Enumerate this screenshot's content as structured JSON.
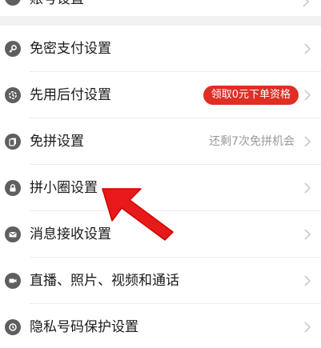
{
  "top_row": {
    "label": "账号设置",
    "icon": "settings-icon"
  },
  "rows": [
    {
      "label": "免密支付设置",
      "icon": "key-icon"
    },
    {
      "label": "先用后付设置",
      "icon": "pay-later-icon",
      "badge": "领取0元下单资格"
    },
    {
      "label": "免拼设置",
      "icon": "group-free-icon",
      "hint": "还剩7次免拼机会"
    },
    {
      "label": "拼小圈设置",
      "icon": "lock-icon"
    },
    {
      "label": "消息接收设置",
      "icon": "mail-icon"
    },
    {
      "label": "直播、照片、视频和通话",
      "icon": "video-icon"
    },
    {
      "label": "隐私号码保护设置",
      "icon": "phone-shield-icon"
    }
  ],
  "colors": {
    "accent": "#e02e24",
    "icon": "#5f5f5f",
    "hint": "#9a9a9a",
    "section_gap": "#f2f2f2"
  }
}
